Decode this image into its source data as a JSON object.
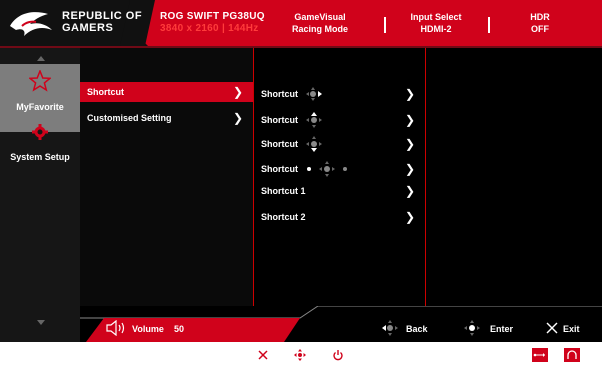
{
  "header": {
    "brand_line1": "REPUBLIC OF",
    "brand_line2": "GAMERS",
    "model_line1": "ROG SWIFT PG38UQ",
    "model_line2": "3840 x 2160 | 144Hz",
    "status": [
      {
        "line1": "GameVisual",
        "line2": "Racing Mode"
      },
      {
        "line1": "Input Select",
        "line2": "HDMI-2"
      },
      {
        "line1": "HDR",
        "line2": "OFF"
      }
    ]
  },
  "nav": {
    "items": [
      {
        "label": "MyFavorite",
        "icon": "star-icon",
        "selected": true
      },
      {
        "label": "System Setup",
        "icon": "gear-icon",
        "selected": false
      }
    ]
  },
  "menu": {
    "items": [
      {
        "label": "Shortcut",
        "selected": true
      },
      {
        "label": "Customised Setting",
        "selected": false
      }
    ]
  },
  "submenu": {
    "items": [
      {
        "label": "Shortcut",
        "icon": "joystick-right-icon"
      },
      {
        "label": "Shortcut",
        "icon": "joystick-up-icon"
      },
      {
        "label": "Shortcut",
        "icon": "joystick-down-icon"
      },
      {
        "label": "Shortcut",
        "icon": "joystick-press-icon"
      },
      {
        "label": "Shortcut 1",
        "icon": ""
      },
      {
        "label": "Shortcut 2",
        "icon": ""
      }
    ]
  },
  "footer": {
    "volume_label": "Volume",
    "volume_value": "50",
    "back_label": "Back",
    "enter_label": "Enter",
    "exit_label": "Exit"
  },
  "colors": {
    "accent": "#d0021b",
    "bg": "#000000",
    "nav_selected": "#7d7d7d"
  }
}
